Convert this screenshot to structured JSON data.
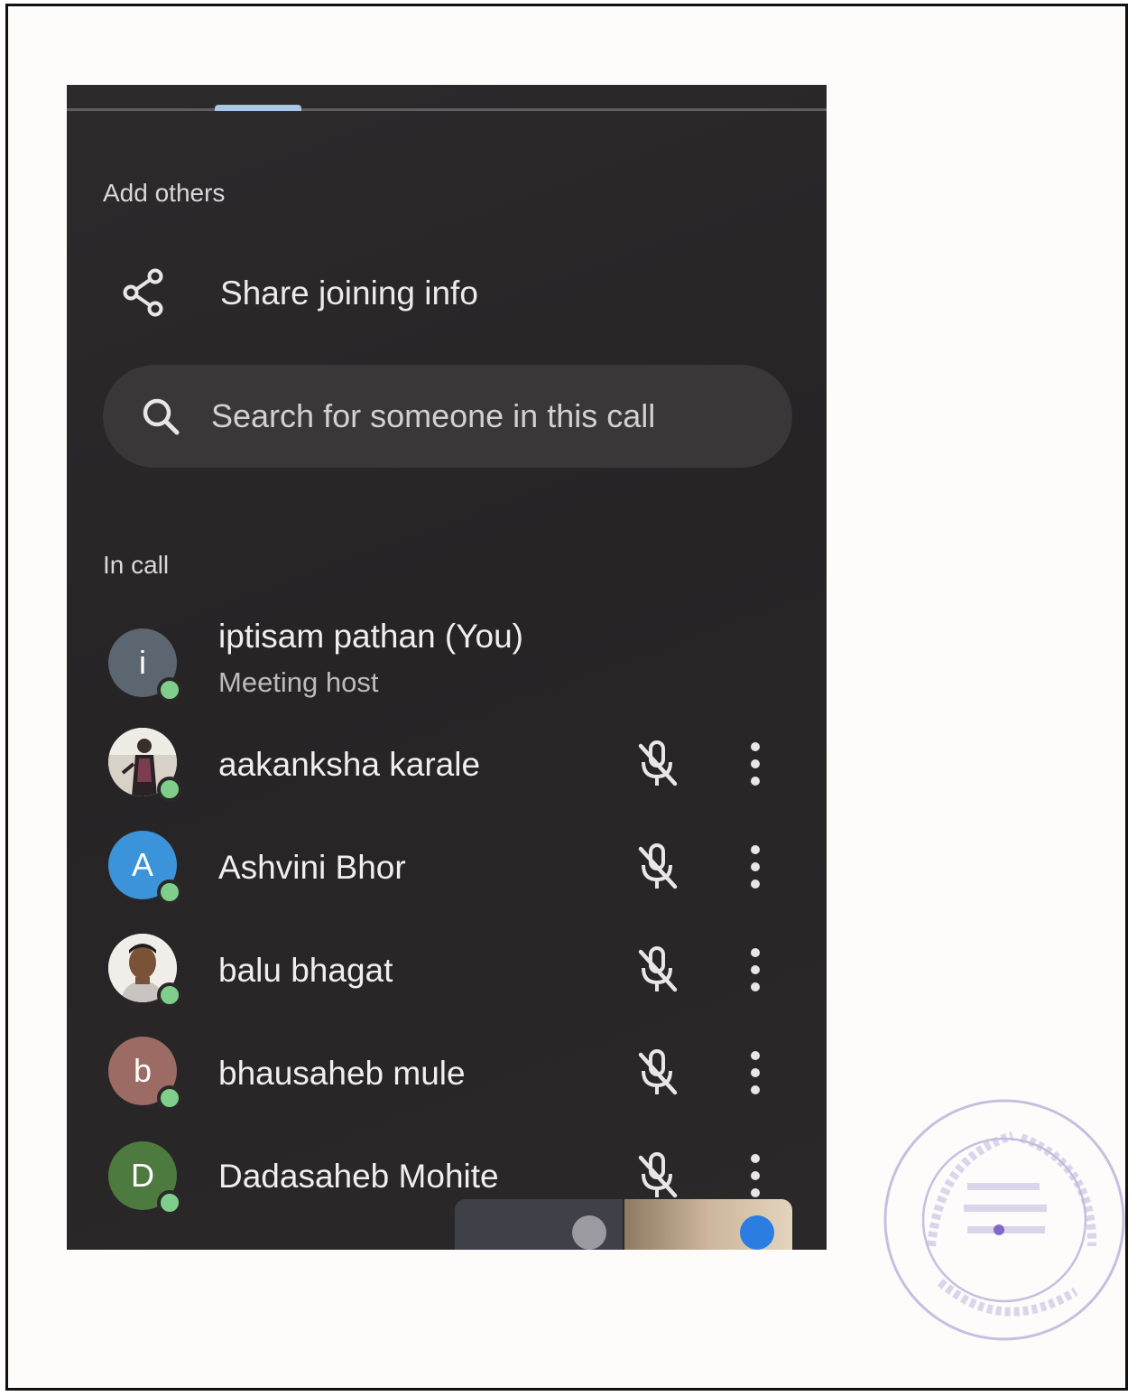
{
  "add_others_label": "Add others",
  "share": {
    "label": "Share joining info",
    "icon": "share-icon"
  },
  "search": {
    "placeholder": "Search for someone in this call",
    "icon": "search-icon"
  },
  "in_call_label": "In call",
  "participants": [
    {
      "initial": "i",
      "name": "iptisam pathan (You)",
      "subtitle": "Meeting host",
      "avatar_color": "#5b6670",
      "photo": false,
      "muted": false
    },
    {
      "initial": "",
      "name": "aakanksha karale",
      "avatar_color": "#c9c2b8",
      "photo": true,
      "muted": true
    },
    {
      "initial": "A",
      "name": "Ashvini Bhor",
      "avatar_color": "#3b93d9",
      "photo": false,
      "muted": true
    },
    {
      "initial": "",
      "name": "balu bhagat",
      "avatar_color": "#d8cfc3",
      "photo": true,
      "muted": true
    },
    {
      "initial": "b",
      "name": "bhausaheb mule",
      "avatar_color": "#9c6b63",
      "photo": false,
      "muted": true
    },
    {
      "initial": "D",
      "name": "Dadasaheb Mohite",
      "avatar_color": "#4d7a3e",
      "photo": false,
      "muted": true
    }
  ],
  "colors": {
    "panel_bg": "#2a2828",
    "online_dot": "#7fcf8a",
    "search_bg": "#3a3739",
    "speaking": "#2a7de1"
  }
}
